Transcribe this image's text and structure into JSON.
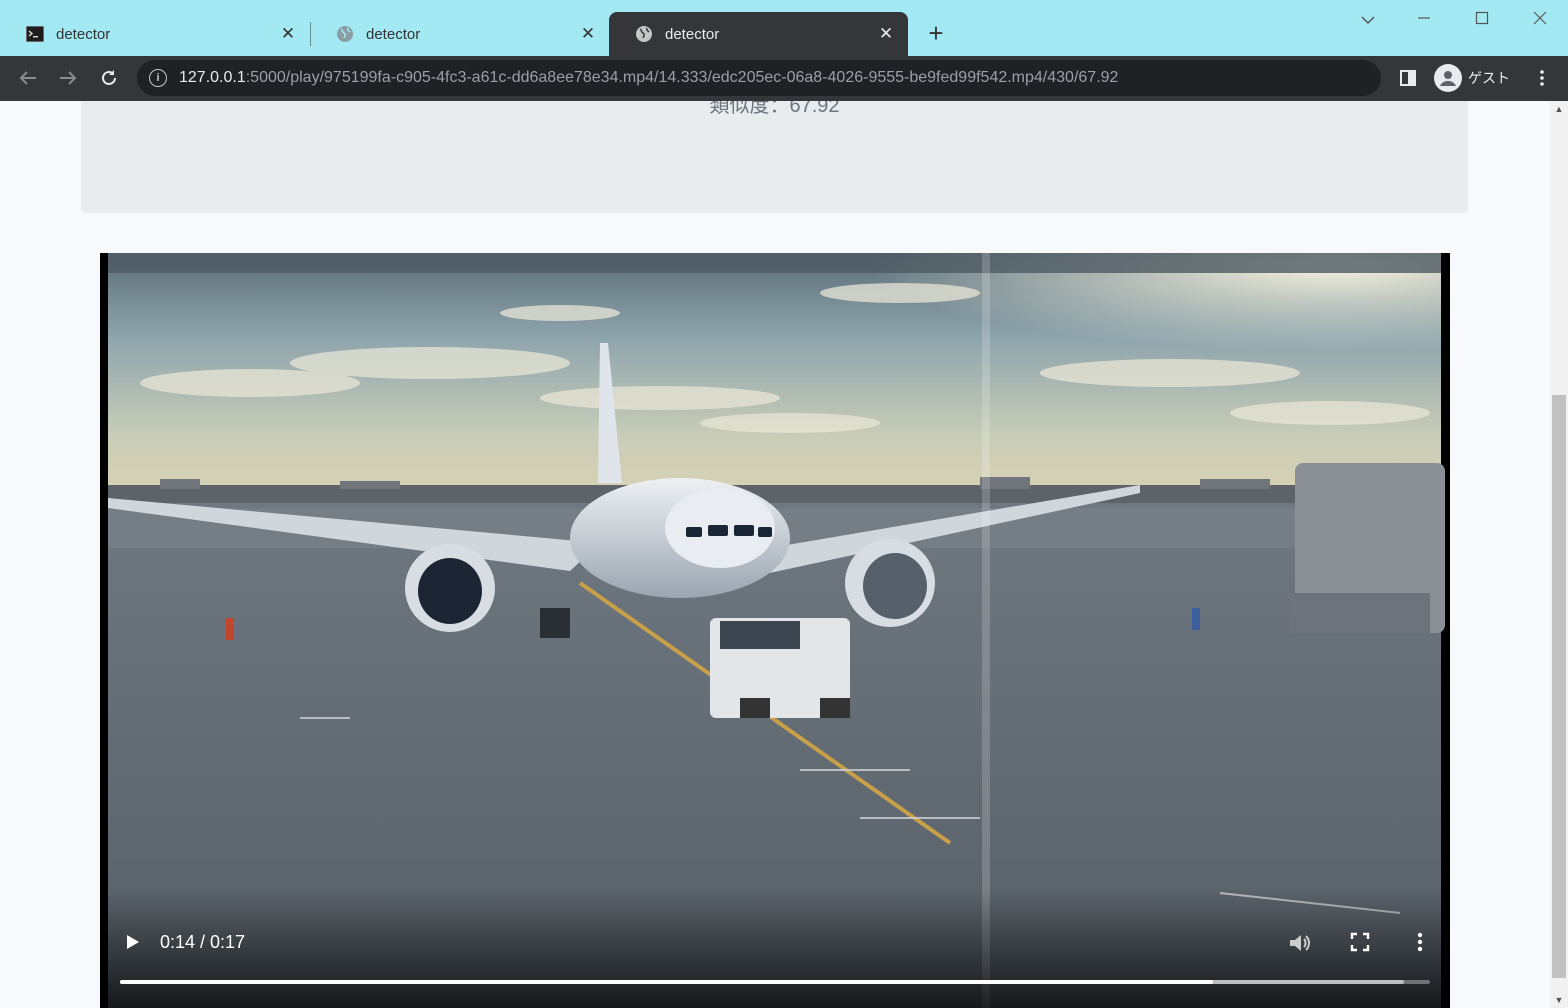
{
  "browser": {
    "tabs": [
      {
        "title": "detector",
        "icon": "terminal-icon",
        "active": false
      },
      {
        "title": "detector",
        "icon": "globe-icon",
        "active": false
      },
      {
        "title": "detector",
        "icon": "globe-icon",
        "active": true
      }
    ],
    "url_host": "127.0.0.1",
    "url_path": ":5000/play/975199fa-c905-4fc3-a61c-dd6a8ee78e34.mp4/14.333/edc205ec-06a8-4026-9555-be9fed99f542.mp4/430/67.92",
    "profile_label": "ゲスト",
    "colors": {
      "tabstrip": "#a3e9f3",
      "toolbar": "#35363a",
      "omnibox": "#202124"
    }
  },
  "page": {
    "similarity_text": "類似度：67.92",
    "video": {
      "current_time": "0:14",
      "duration": "0:17",
      "time_display": "0:14 / 0:17",
      "progress_fraction": 0.834,
      "buffered_fraction": 0.98,
      "state": "paused"
    }
  }
}
